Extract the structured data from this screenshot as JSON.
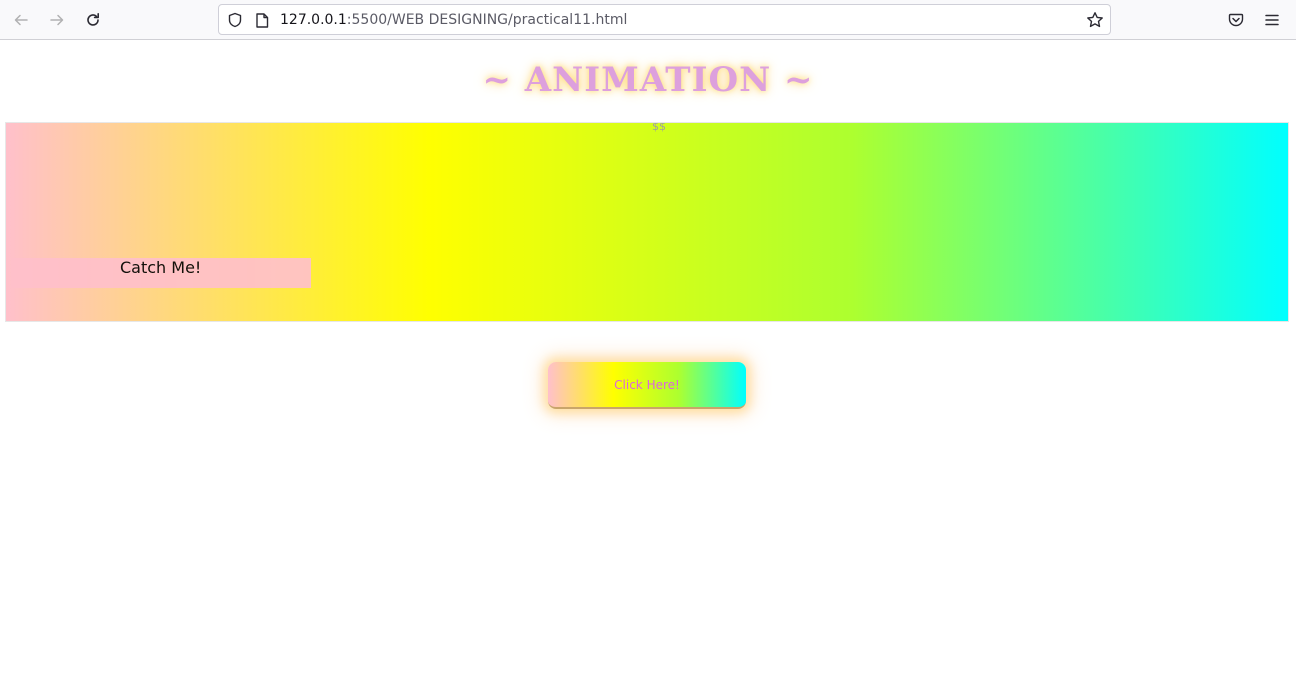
{
  "browser": {
    "url_host": "127.0.0.1",
    "url_rest": ":5500/WEB DESIGNING/practical11.html",
    "icons": {
      "back": "back-arrow-icon",
      "forward": "forward-arrow-icon",
      "reload": "reload-icon",
      "shield": "shield-icon",
      "page": "page-icon",
      "bookmark": "star-icon",
      "pocket": "pocket-icon",
      "menu": "hamburger-menu-icon"
    }
  },
  "page": {
    "title": "~ ANIMATION ~",
    "catch_me_label": "Catch Me!",
    "dollar_stream": "$$$$$$$$$$$$$$$$$$$$$$$$$$",
    "click_button_label": "Click Here!"
  },
  "colors": {
    "title_text": "#dda0dd",
    "title_glow": "#ffe27a",
    "gradient": [
      "#ffc0cb",
      "#ffff00",
      "#adff2f",
      "#00ffff"
    ],
    "catch_me_bg": "#ffc0cb",
    "button_text": "#dd66dd",
    "dollar_color": "#a0a0a0"
  }
}
